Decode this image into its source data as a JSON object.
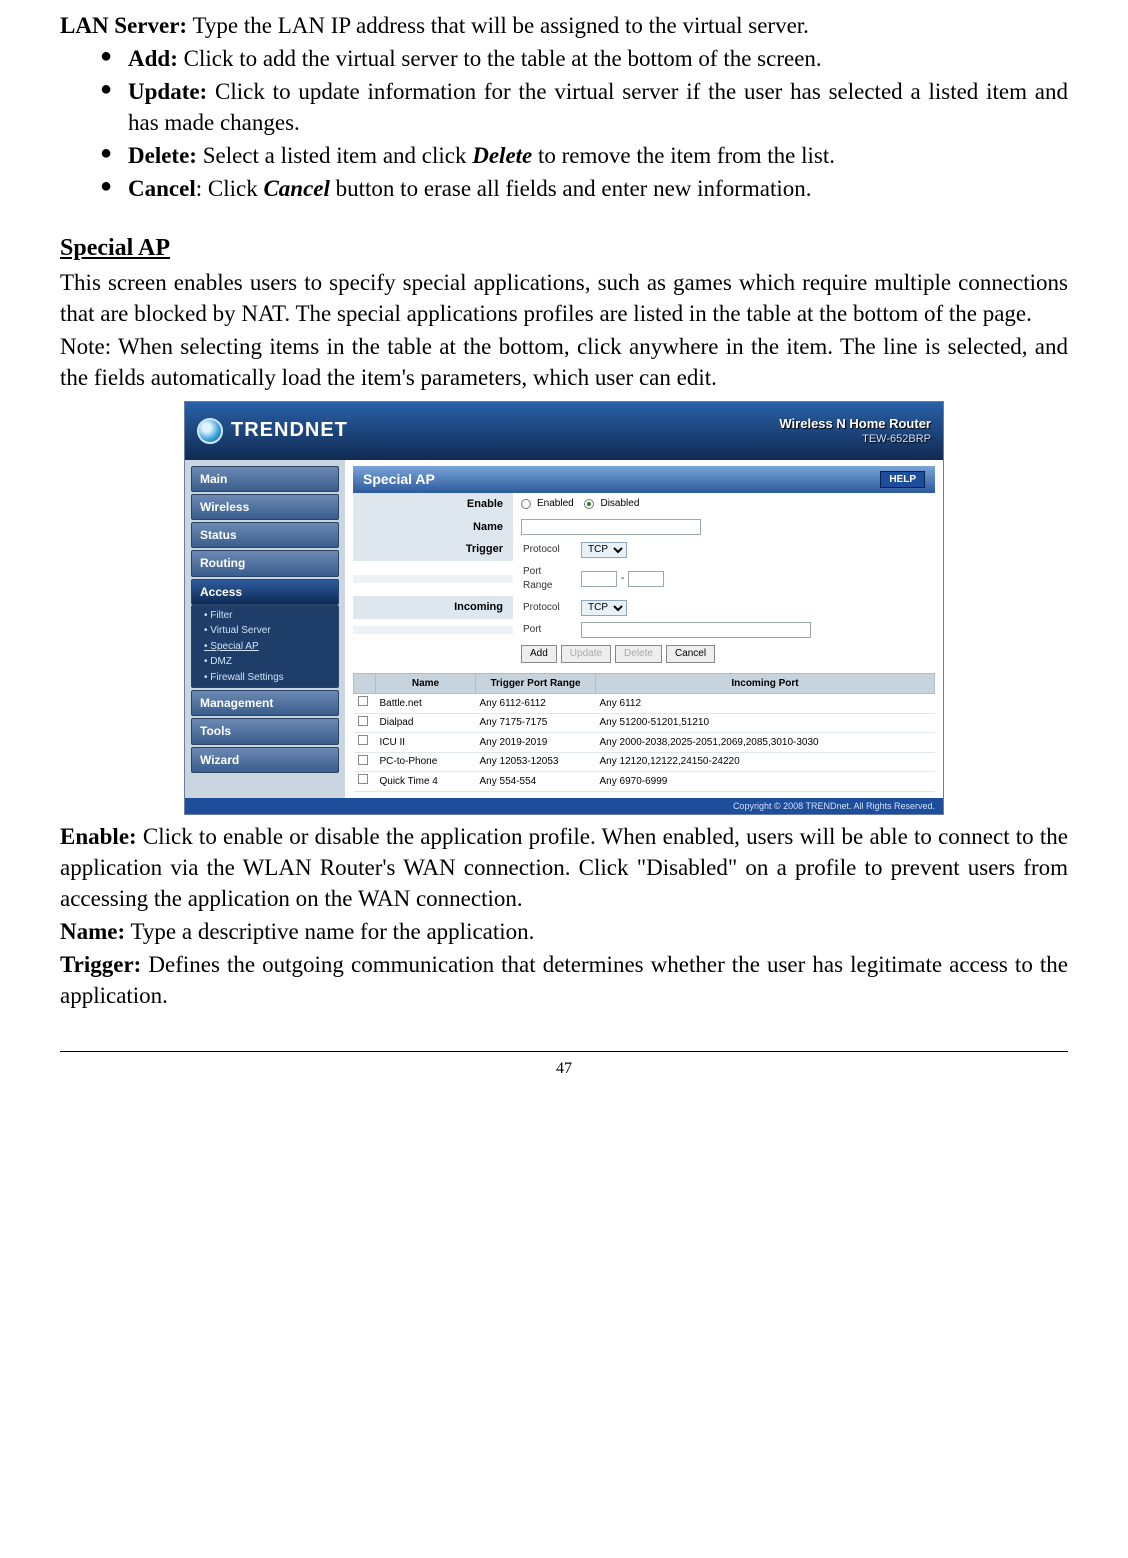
{
  "top": {
    "lan_label": "LAN Server:",
    "lan_text": " Type the LAN IP address that will be assigned to the virtual server.",
    "bullets": [
      {
        "label": "Add:",
        "text": " Click to add the virtual server to the table at the bottom of the screen."
      },
      {
        "label": "Update:",
        "text": " Click to update information for the virtual server if the user has selected a listed item and has made changes."
      },
      {
        "label": "Delete:",
        "text_pre": " Select a listed item and click ",
        "em": "Delete",
        "text_post": " to remove the item from the list."
      },
      {
        "label": "Cancel",
        "colon": ": ",
        "text_pre": "Click ",
        "em": "Cancel",
        "text_post": " button to erase all fields and enter new information."
      }
    ]
  },
  "section": {
    "heading": "Special AP",
    "p1": "This screen enables users to specify special applications, such as games which require multiple connections that are blocked by NAT. The special applications profiles are listed in the table at the bottom of the page.",
    "p2": "Note: When selecting items in the table at the bottom, click anywhere in the item. The line is selected, and the fields automatically load the item's parameters, which user can edit."
  },
  "shot": {
    "brand": "TRENDNET",
    "header_line1": "Wireless N Home Router",
    "header_line2": "TEW-652BRP",
    "sidebar": [
      "Main",
      "Wireless",
      "Status",
      "Routing",
      "Access"
    ],
    "subs": [
      "Filter",
      "Virtual Server",
      "Special AP",
      "DMZ",
      "Firewall Settings"
    ],
    "sidebar2": [
      "Management",
      "Tools",
      "Wizard"
    ],
    "panel_title": "Special AP",
    "help": "HELP",
    "labels": {
      "enable": "Enable",
      "name": "Name",
      "trigger": "Trigger",
      "incoming": "Incoming",
      "protocol": "Protocol",
      "port_range": "Port Range",
      "port": "Port",
      "enabled": "Enabled",
      "disabled": "Disabled",
      "tcp": "TCP"
    },
    "buttons": {
      "add": "Add",
      "update": "Update",
      "delete": "Delete",
      "cancel": "Cancel"
    },
    "table": {
      "headers": [
        "",
        "Name",
        "Trigger Port Range",
        "Incoming Port"
      ],
      "rows": [
        [
          "Battle.net",
          "Any 6112-6112",
          "Any 6112"
        ],
        [
          "Dialpad",
          "Any 7175-7175",
          "Any 51200-51201,51210"
        ],
        [
          "ICU II",
          "Any 2019-2019",
          "Any 2000-2038,2025-2051,2069,2085,3010-3030"
        ],
        [
          "PC-to-Phone",
          "Any 12053-12053",
          "Any 12120,12122,24150-24220"
        ],
        [
          "Quick Time 4",
          "Any 554-554",
          "Any 6970-6999"
        ]
      ]
    },
    "footer": "Copyright © 2008 TRENDnet. All Rights Reserved."
  },
  "defs": {
    "enable": {
      "label": "Enable:",
      "text": " Click to enable or disable the application profile. When enabled, users will be able to connect to the application via the WLAN Router's WAN connection. Click \"Disabled\" on a profile to prevent users from accessing the application on the WAN connection."
    },
    "name": {
      "label": "Name:",
      "text": " Type a descriptive name for the application."
    },
    "trigger": {
      "label": "Trigger:",
      "text": " Defines the outgoing communication that determines whether the user has legitimate access to the application."
    }
  },
  "page_number": "47"
}
